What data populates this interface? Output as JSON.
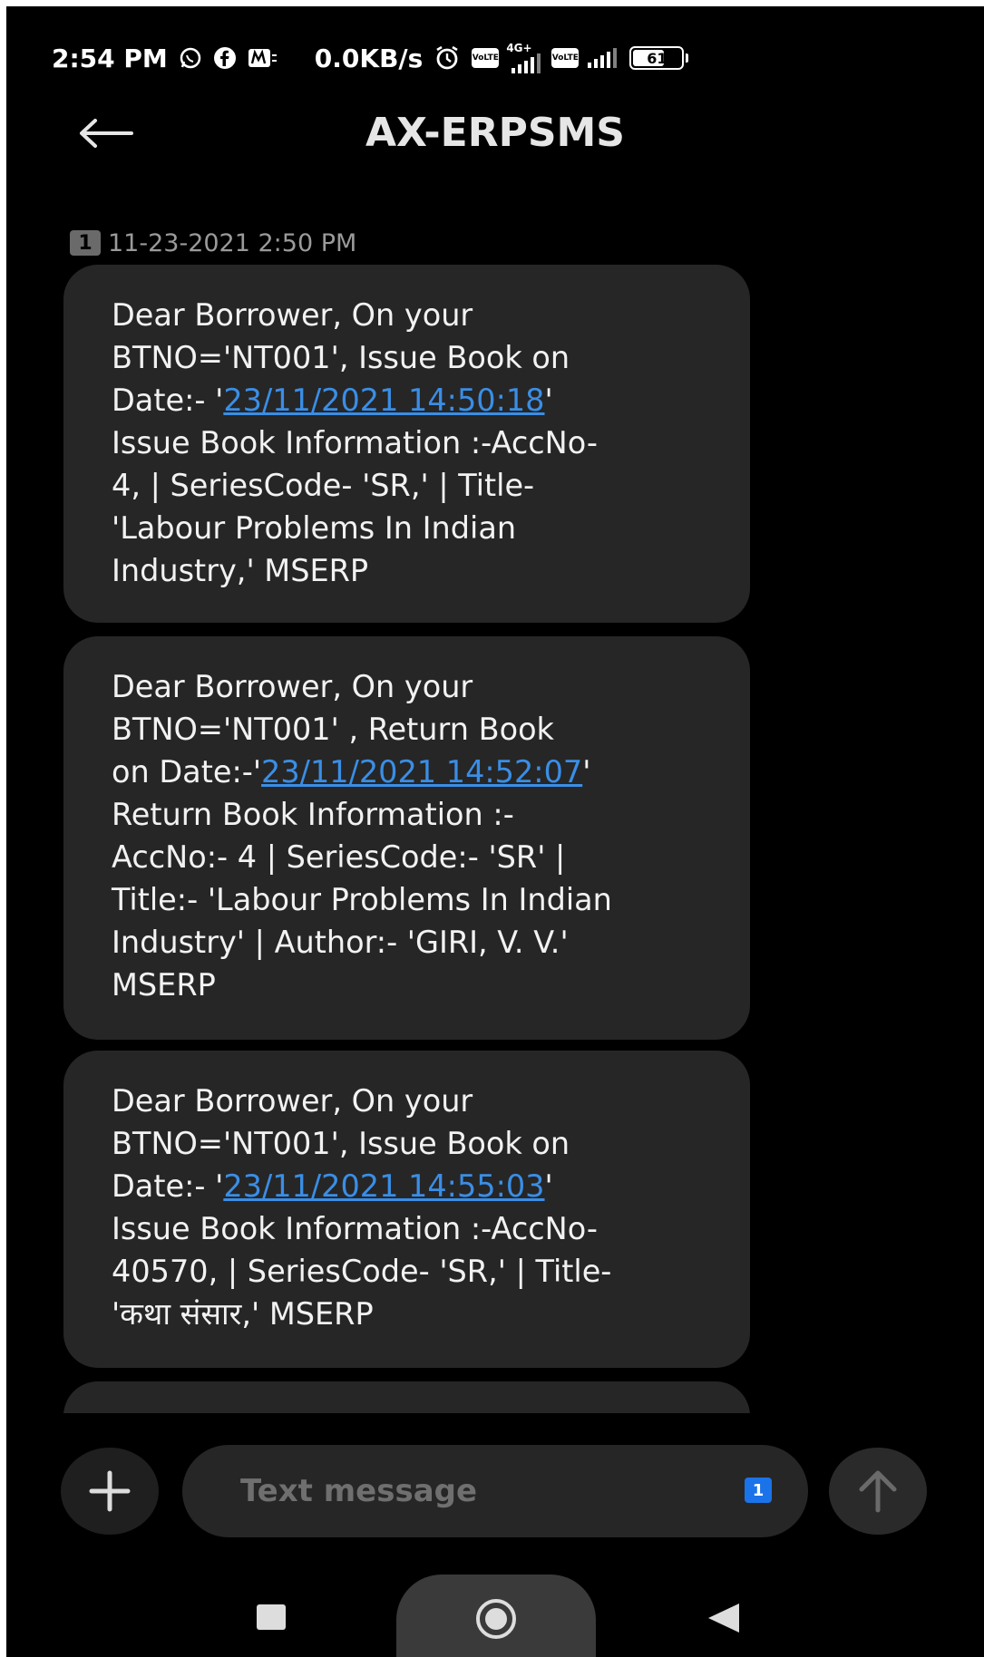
{
  "status_bar": {
    "time": "2:54 PM",
    "network_speed": "0.0KB/s",
    "network_type": "4G+",
    "volte_label": "Vo\nLTE",
    "battery_level": "61",
    "icons": [
      "whatsapp-icon",
      "facebook-icon",
      "m-app-icon",
      "alarm-icon",
      "volte-icon",
      "signal-icon",
      "battery-icon"
    ]
  },
  "header": {
    "title": "AX-ERPSMS",
    "back_icon": "arrow-left-icon"
  },
  "conversation": {
    "sim_badge": "1",
    "timestamp": "11-23-2021 2:50 PM",
    "messages": [
      {
        "pre": "Dear Borrower, On your\nBTNO='NT001', Issue Book on\nDate:- '",
        "link": "23/11/2021 14:50:18",
        "post": "'\nIssue Book Information :-AccNo-\n4, | SeriesCode- 'SR,' | Title-\n'Labour Problems In Indian\nIndustry,' MSERP"
      },
      {
        "pre": "Dear Borrower, On your\nBTNO='NT001' , Return Book\non Date:-'",
        "link": "23/11/2021 14:52:07",
        "post": "'\nReturn Book Information :-\nAccNo:- 4 | SeriesCode:- 'SR' |\nTitle:- 'Labour Problems In Indian\nIndustry' | Author:- 'GIRI, V. V.'\nMSERP"
      },
      {
        "pre": "Dear Borrower, On your\nBTNO='NT001', Issue Book on\nDate:- '",
        "link": "23/11/2021 14:55:03",
        "post": "'\nIssue Book Information :-AccNo-\n40570, | SeriesCode- 'SR,' | Title-\n'कथा संसार,' MSERP"
      }
    ]
  },
  "composer": {
    "placeholder": "Text message",
    "sim_label": "1",
    "add_icon": "plus-icon",
    "send_icon": "arrow-up-icon"
  },
  "nav_bar": {
    "icons": [
      "recents-square-icon",
      "home-circle-icon",
      "back-triangle-icon"
    ]
  },
  "colors": {
    "background": "#000000",
    "bubble": "#262626",
    "link": "#3a8ee6",
    "sim_accent": "#1a73e8"
  }
}
